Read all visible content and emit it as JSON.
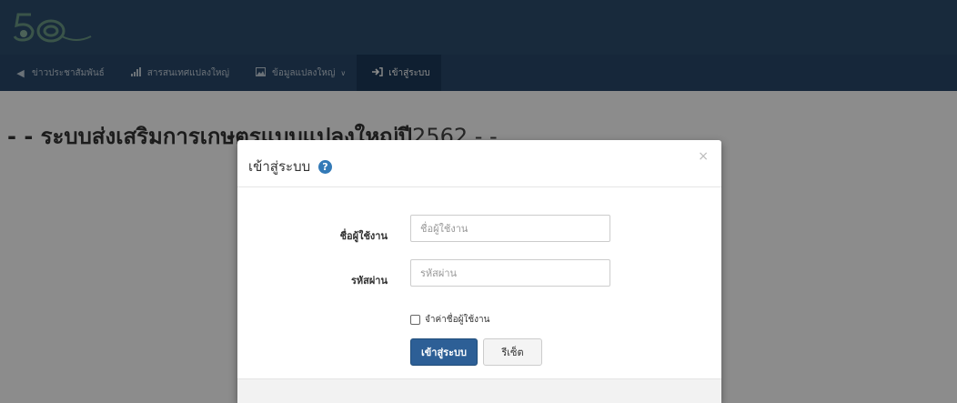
{
  "header": {
    "logo_icon": "anniversary-50-logo"
  },
  "navbar": {
    "items": [
      {
        "label": "ข่าวประชาสัมพันธ์",
        "icon": "bullhorn-icon",
        "glyph": "◀"
      },
      {
        "label": "สารสนเทศแปลงใหญ่",
        "icon": "bar-chart-icon",
        "glyph": "▁▃▅"
      },
      {
        "label": "ข้อมูลแปลงใหญ่",
        "icon": "image-icon",
        "glyph": "▣",
        "dropdown": true
      },
      {
        "label": "เข้าสู่ระบบ",
        "icon": "sign-in-icon",
        "glyph": "⇥",
        "active": true
      }
    ]
  },
  "main": {
    "title_prefix": "- - ระบบส่งเสริมการเกษตรแบบแปลงใหญ่ปี",
    "title_year": "2562",
    "title_suffix": " - -"
  },
  "modal": {
    "title": "เข้าสู่ระบบ",
    "help_glyph": "?",
    "close_glyph": "×",
    "username_label": "ชื่อผู้ใช้งาน",
    "username_placeholder": "ชื่อผู้ใช้งาน",
    "password_label": "รหัสผ่าน",
    "password_placeholder": "รหัสผ่าน",
    "remember_label": "จำค่าชื่อผู้ใช้งาน",
    "remember_checked": false,
    "login_button": "เข้าสู่ระบบ",
    "reset_button": "รีเซ็ต"
  },
  "colors": {
    "header_bg": "#2d4e6e",
    "navbar_bg": "#28486a",
    "primary_button": "#2d5f96",
    "help_icon": "#337ab7"
  }
}
